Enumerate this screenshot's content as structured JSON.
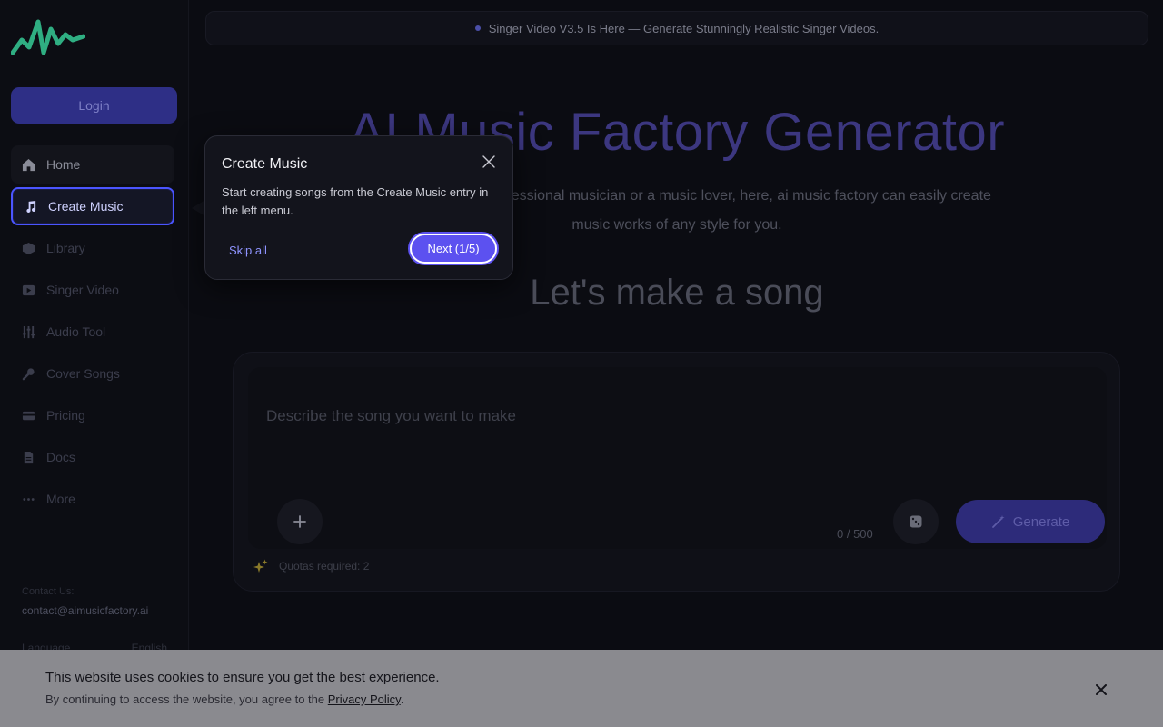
{
  "sidebar": {
    "login_label": "Login",
    "nav": [
      {
        "label": "Home",
        "icon": "home-icon"
      },
      {
        "label": "Create Music",
        "icon": "music-note-icon"
      },
      {
        "label": "Library",
        "icon": "box-icon"
      },
      {
        "label": "Singer Video",
        "icon": "video-play-icon"
      },
      {
        "label": "Audio Tool",
        "icon": "sliders-icon"
      },
      {
        "label": "Cover Songs",
        "icon": "microphone-icon"
      },
      {
        "label": "Pricing",
        "icon": "credit-card-icon"
      },
      {
        "label": "Docs",
        "icon": "document-icon"
      },
      {
        "label": "More",
        "icon": "more-dots-icon"
      }
    ],
    "contact_label": "Contact Us:",
    "contact_email": "contact@aimusicfactory.ai",
    "language_label": "Language",
    "language_value": "English"
  },
  "banner": {
    "text": "Singer Video V3.5 Is Here — Generate Stunningly Realistic Singer Videos."
  },
  "hero": {
    "title": "AI Music Factory Generator",
    "subtitle": "Whether you are a professional musician or a music lover, here, ai music factory can easily create music works of any style for you."
  },
  "composer": {
    "section_title": "Let's make a song",
    "placeholder": "Describe the song you want to make",
    "counter": "0 / 500",
    "generate_label": "Generate",
    "quota_text": "Quotas required: 2"
  },
  "tour": {
    "title": "Create Music",
    "body": "Start creating songs from the Create Music entry in the left menu.",
    "skip_label": "Skip all",
    "next_label": "Next (1/5)"
  },
  "cookie": {
    "title": "This website uses cookies to ensure you get the best experience.",
    "text_prefix": "By continuing to access the website, you agree to the ",
    "link_label": "Privacy Policy",
    "text_suffix": "."
  },
  "colors": {
    "accent": "#5c51f0",
    "active_border": "#4b55ff",
    "background": "#0b0c12",
    "logo": "#2fae82"
  }
}
